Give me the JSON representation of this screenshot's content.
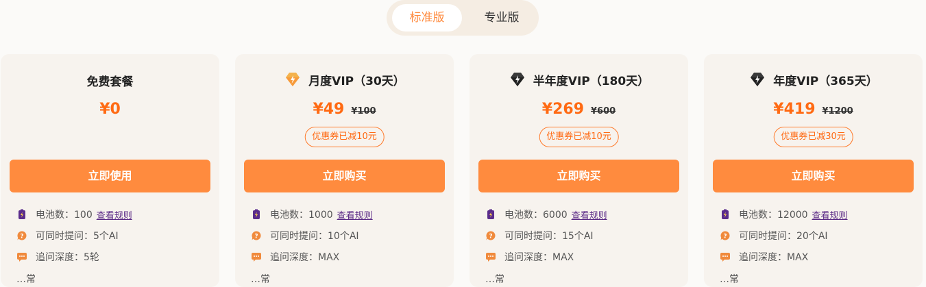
{
  "tabs": {
    "standard": "标准版",
    "pro": "专业版"
  },
  "colors": {
    "accent": "#ff8b3e",
    "price": "#ff6a13",
    "card_bg": "#f7f3ee"
  },
  "cards": [
    {
      "title": "免费套餐",
      "price": "¥0",
      "cta": "立即使用",
      "battery_label": "电池数：100",
      "rules_link": "查看规则",
      "concurrent": "可同时提问：5个AI",
      "depth": "追问深度：5轮",
      "partial_line": "…常"
    },
    {
      "title": "月度VIP（30天）",
      "icon": "gold-diamond-icon",
      "price": "¥49",
      "original_price": "¥100",
      "coupon": "优惠券已减10元",
      "cta": "立即购买",
      "battery_label": "电池数：1000",
      "rules_link": "查看规则",
      "concurrent": "可同时提问：10个AI",
      "depth": "追问深度：MAX",
      "partial_line": "…常"
    },
    {
      "title": "半年度VIP（180天）",
      "icon": "dark-diamond-icon",
      "price": "¥269",
      "original_price": "¥600",
      "coupon": "优惠券已减10元",
      "cta": "立即购买",
      "battery_label": "电池数：6000",
      "rules_link": "查看规则",
      "concurrent": "可同时提问：15个AI",
      "depth": "追问深度：MAX",
      "partial_line": "…常"
    },
    {
      "title": "年度VIP（365天）",
      "icon": "dark-diamond-icon",
      "price": "¥419",
      "original_price": "¥1200",
      "coupon": "优惠券已减30元",
      "cta": "立即购买",
      "battery_label": "电池数：12000",
      "rules_link": "查看规则",
      "concurrent": "可同时提问：20个AI",
      "depth": "追问深度：MAX",
      "partial_line": "…常"
    }
  ]
}
